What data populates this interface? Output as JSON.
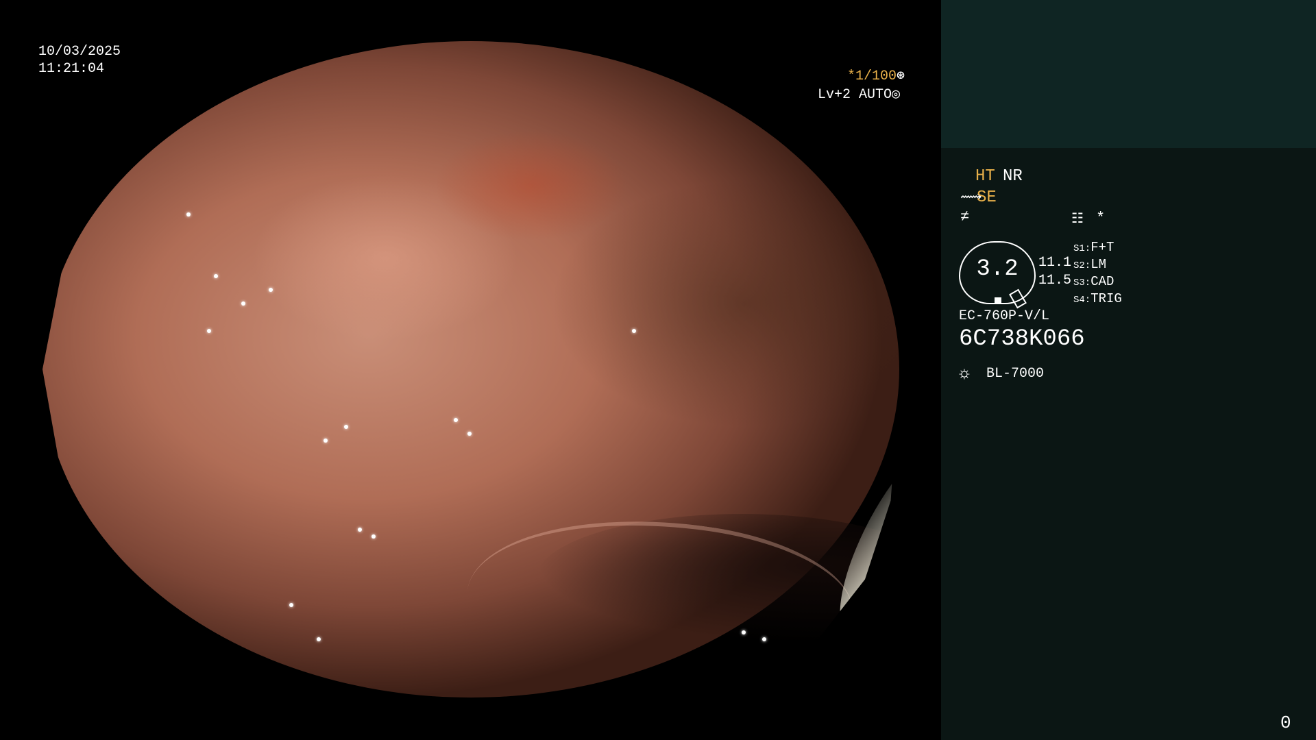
{
  "overlay": {
    "date": "10/03/2025",
    "time": "11:21:04",
    "shutter": "*1/100",
    "shutter_icon": "⊛",
    "iris": "Lv+2 AUTO",
    "iris_icon": "◎"
  },
  "panel": {
    "ht_label": "HT",
    "nr_label": "NR",
    "se_icon": "⟿",
    "se_label": "SE",
    "wave_icon": "≠",
    "menu_icon": "☷",
    "star_label": "*",
    "dial_value": "3.2",
    "value_1": "11.1",
    "value_2": "11.5",
    "slots": [
      {
        "key": "S1:",
        "value": "F+T"
      },
      {
        "key": "S2:",
        "value": "LM"
      },
      {
        "key": "S3:",
        "value": "CAD"
      },
      {
        "key": "S4:",
        "value": "TRIG"
      }
    ],
    "model": "EC-760P-V/L",
    "serial": "6C738K066",
    "sun_icon": "☼",
    "light_source": "BL-7000",
    "corner_count": "0"
  },
  "colors": {
    "accent_yellow": "#e8b04a",
    "panel_bg": "#0b1614",
    "panel_top_bg": "#0f2523"
  }
}
